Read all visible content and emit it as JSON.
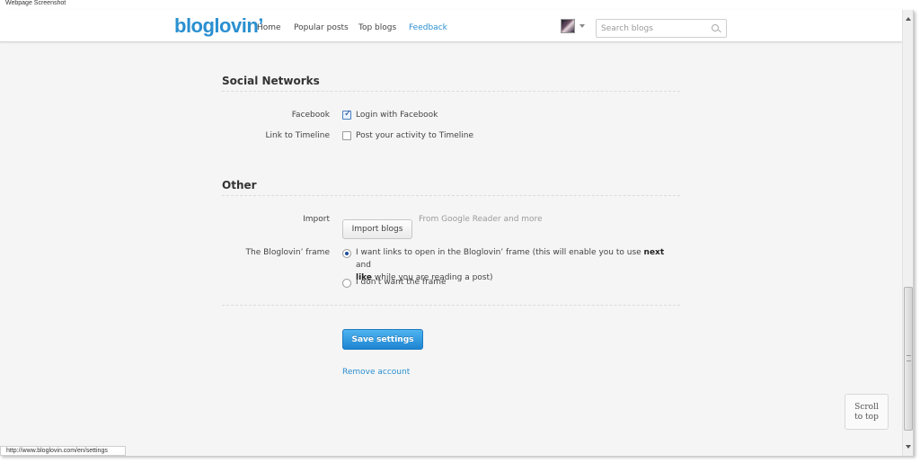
{
  "window": {
    "caption": "Webpage Screenshot"
  },
  "header": {
    "logo": "bloglovin’",
    "nav": [
      "Home",
      "Popular posts",
      "Top blogs",
      "Feedback"
    ],
    "search_placeholder": "Search blogs"
  },
  "social": {
    "title": "Social Networks",
    "facebook_label": "Facebook",
    "facebook_option": "Login with Facebook",
    "facebook_checked": true,
    "timeline_label": "Link to Timeline",
    "timeline_option": "Post your activity to Timeline",
    "timeline_checked": false
  },
  "other": {
    "title": "Other",
    "import_label": "Import",
    "import_button": "Import blogs",
    "import_note": "From Google Reader and more",
    "frame_label": "The Bloglovin’ frame",
    "frame_option1_part1": "I want links to open in the Bloglovin’ frame (this will enable you to use ",
    "frame_option1_next": "next",
    "frame_option1_part2": " and",
    "frame_option1_like": "like",
    "frame_option1_part3": " while you are reading a post)",
    "frame_option2": "I don't want the frame",
    "frame_selected": 1
  },
  "actions": {
    "save_button": "Save settings",
    "remove_link": "Remove account"
  },
  "scroll_to_top": {
    "line1": "Scroll",
    "line2": "to top"
  },
  "status_url": "http://www.bloglovin.com/en/settings",
  "colors": {
    "brand": "#2a8fd0",
    "save_button": "#1d84d1"
  }
}
